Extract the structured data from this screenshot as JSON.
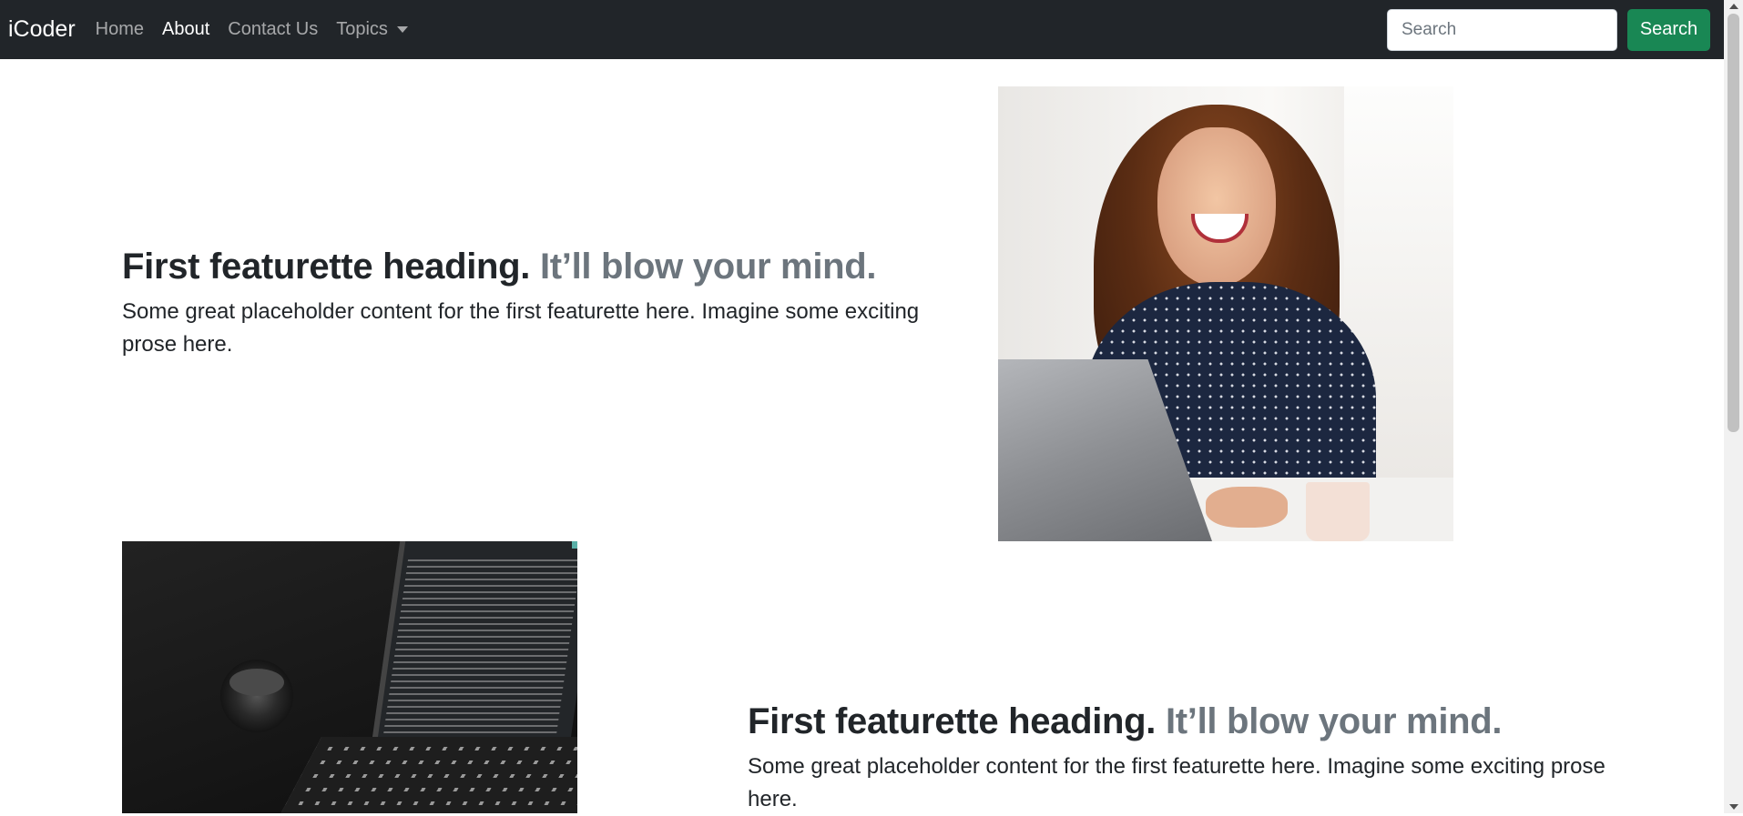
{
  "navbar": {
    "brand": "iCoder",
    "links": [
      {
        "label": "Home",
        "active": false
      },
      {
        "label": "About",
        "active": true
      },
      {
        "label": "Contact Us",
        "active": false
      },
      {
        "label": "Topics",
        "active": false,
        "dropdown": true
      }
    ],
    "search": {
      "placeholder": "Search",
      "value": "",
      "button_label": "Search"
    }
  },
  "featurettes": [
    {
      "heading": "First featurette heading.",
      "heading_muted": "It’ll blow your mind.",
      "lead": "Some great placeholder content for the first featurette here. Imagine some exciting prose here.",
      "image": "woman-laughing-at-laptop"
    },
    {
      "heading": "First featurette heading.",
      "heading_muted": "It’ll blow your mind.",
      "lead": "Some great placeholder content for the first featurette here. Imagine some exciting prose here.",
      "image": "laptop-with-code-and-camera-lens"
    }
  ],
  "colors": {
    "navbar_bg": "#212529",
    "search_button": "#198754",
    "muted_text": "#6c757d"
  }
}
